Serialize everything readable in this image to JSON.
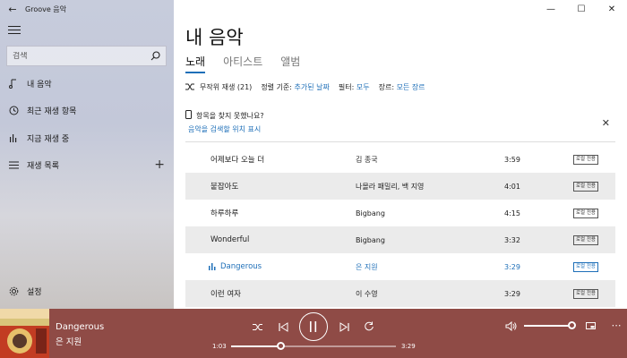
{
  "app": {
    "title": "Groove 음악"
  },
  "window_controls": {
    "minimize": "—",
    "maximize": "☐",
    "close": "✕"
  },
  "sidebar": {
    "search_placeholder": "검색",
    "items": [
      {
        "label": "내 음악",
        "icon": "music-note-icon"
      },
      {
        "label": "최근 재생 항목",
        "icon": "clock-icon"
      },
      {
        "label": "지금 재생 중",
        "icon": "bars-icon"
      },
      {
        "label": "재생 목록",
        "icon": "playlist-icon",
        "action": "+"
      },
      {
        "label": "설정",
        "icon": "gear-icon"
      }
    ]
  },
  "main": {
    "title": "내 음악",
    "tabs": [
      {
        "label": "노래",
        "active": true
      },
      {
        "label": "아티스트"
      },
      {
        "label": "앨범"
      }
    ],
    "filter": {
      "shuffle": "무작위 재생 (21)",
      "sort_label": "정렬 기준:",
      "sort_value": "추가된 날짜",
      "filter_label": "필터:",
      "filter_value": "모두",
      "genre_label": "장르:",
      "genre_value": "모든 장르"
    },
    "notice": {
      "line1": "항목을 찾지 못했나요?",
      "line2": "음악을 검색할 위치 표시"
    },
    "songs": [
      {
        "title": "어제보다 오늘 더",
        "artist": "김 종국",
        "duration": "3:59",
        "badge": "로컬 전용"
      },
      {
        "title": "붙잡아도",
        "artist": "나몰라 패밀리, 백 지영",
        "duration": "4:01",
        "badge": "로컬 전용"
      },
      {
        "title": "하루하루",
        "artist": "Bigbang",
        "duration": "4:15",
        "badge": "로컬 전용"
      },
      {
        "title": "Wonderful",
        "artist": "Bigbang",
        "duration": "3:32",
        "badge": "로컬 전용"
      },
      {
        "title": "Dangerous",
        "artist": "은 지원",
        "duration": "3:29",
        "badge": "로컬 전용",
        "playing": true
      },
      {
        "title": "이런 여자",
        "artist": "이 수영",
        "duration": "3:29",
        "badge": "로컬 전용"
      }
    ]
  },
  "player": {
    "title": "Dangerous",
    "artist": "은 지원",
    "elapsed": "1:03",
    "total": "3:29",
    "progress_fraction": 0.3,
    "volume_fraction": 0.95,
    "accent_color": "#8f4b46"
  },
  "colors": {
    "accent": "#1e6fb8",
    "player_bg": "#8f4b46"
  }
}
